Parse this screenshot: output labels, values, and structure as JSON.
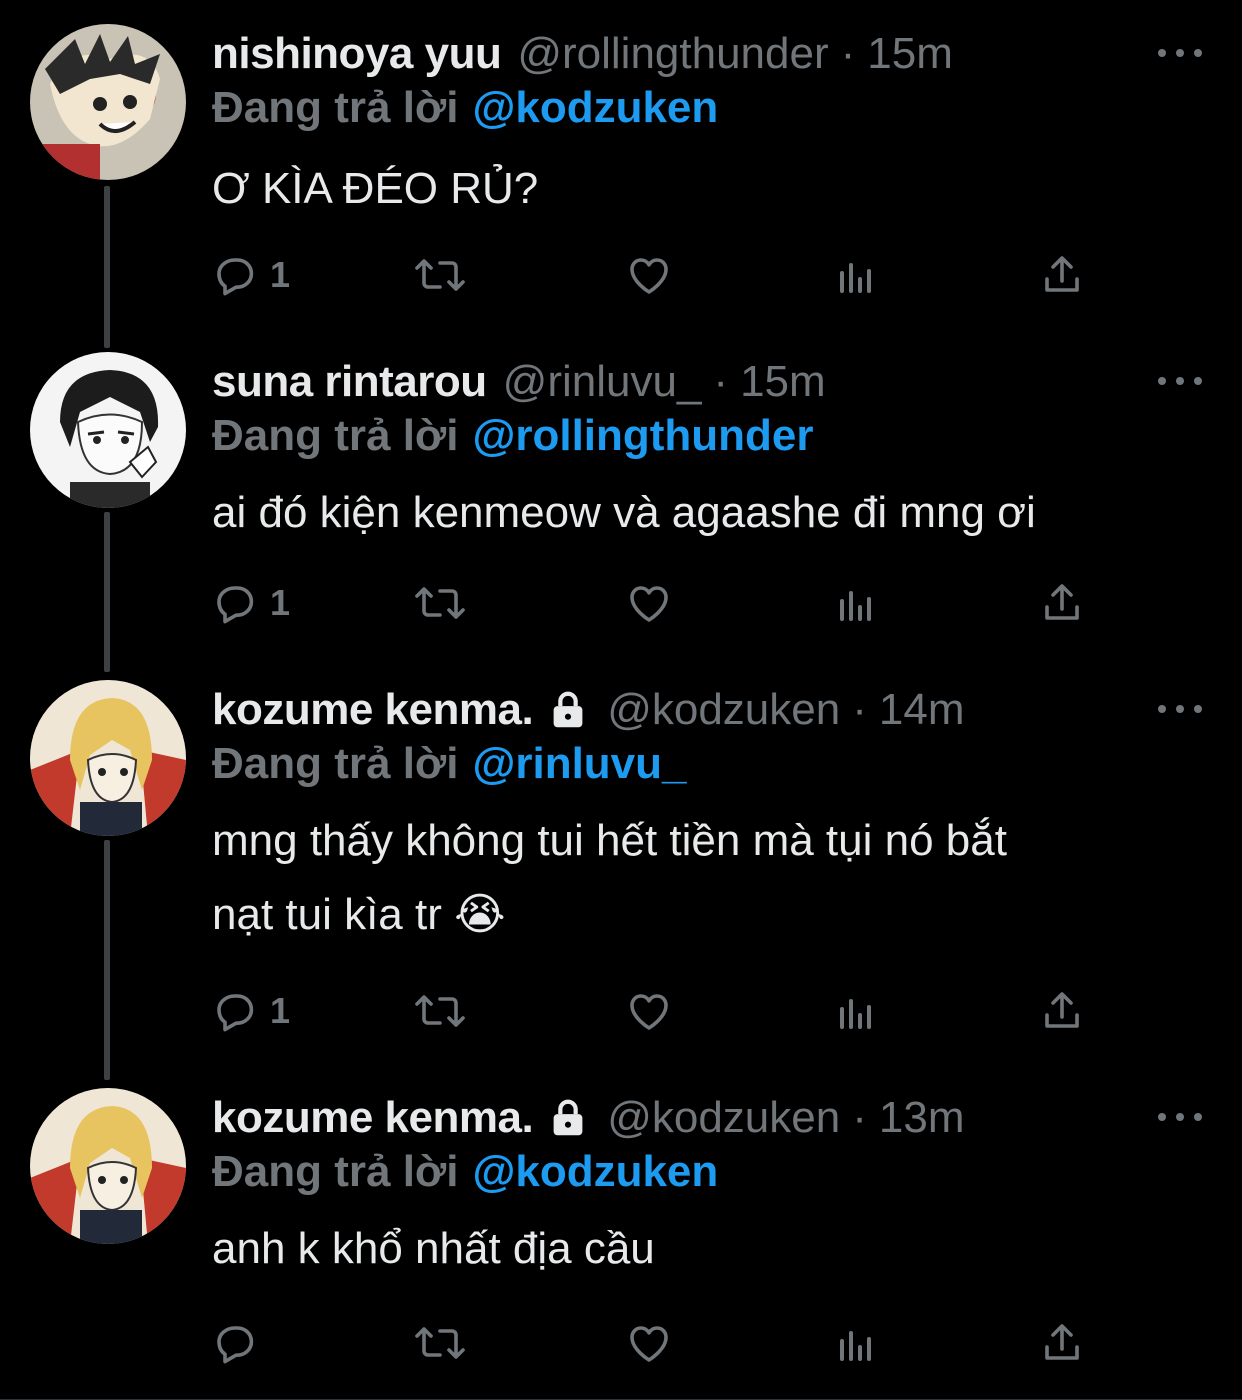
{
  "tweets": [
    {
      "name": "nishinoya yuu",
      "handle": "@rollingthunder",
      "dot": "·",
      "time": "15m",
      "locked": false,
      "reply_prefix": "Đang trả lời",
      "reply_to": "@kodzuken",
      "text_lines": [
        "Ơ KÌA ĐÉO RỦ?"
      ],
      "reply_count": "1"
    },
    {
      "name": "suna rintarou",
      "handle": "@rinluvu_",
      "dot": "·",
      "time": "15m",
      "locked": false,
      "reply_prefix": "Đang trả lời",
      "reply_to": "@rollingthunder",
      "text_lines": [
        "ai đó kiện kenmeow và agaashe đi mng ơi"
      ],
      "reply_count": "1"
    },
    {
      "name": "kozume kenma.",
      "handle": "@kodzuken",
      "dot": "·",
      "time": "14m",
      "locked": true,
      "reply_prefix": "Đang trả lời",
      "reply_to": "@rinluvu_",
      "text_lines": [
        "mng thấy không tui hết tiền mà tụi nó bắt",
        "nạt tui kìa tr 😭"
      ],
      "reply_count": "1"
    },
    {
      "name": "kozume kenma.",
      "handle": "@kodzuken",
      "dot": "·",
      "time": "13m",
      "locked": true,
      "reply_prefix": "Đang trả lời",
      "reply_to": "@kodzuken",
      "text_lines": [
        "anh k khổ nhất địa cầu"
      ],
      "reply_count": ""
    }
  ],
  "icons": {
    "reply": "reply-icon",
    "retweet": "retweet-icon",
    "like": "heart-icon",
    "analytics": "analytics-icon",
    "share": "share-icon",
    "more": "more-icon",
    "lock": "lock-icon"
  },
  "colors": {
    "background": "#000000",
    "text": "#e7e9ea",
    "muted": "#71767b",
    "mention": "#1d9bf0",
    "thread_line": "#3e4144"
  }
}
